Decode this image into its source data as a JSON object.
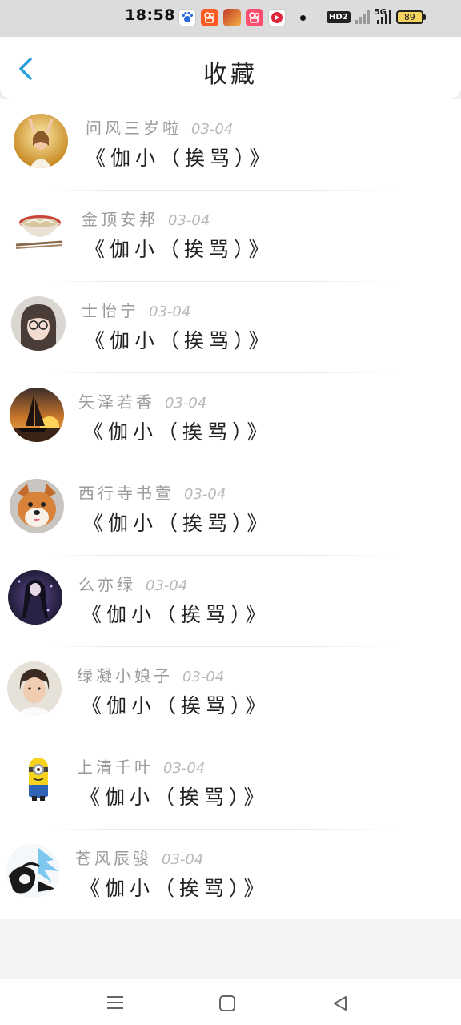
{
  "status_bar": {
    "time": "18:58",
    "hd_label": "HD2",
    "network_label": "5G",
    "battery_level": "89"
  },
  "header": {
    "title": "收藏",
    "back_icon": "chevron-left-icon",
    "accent_color": "#2a9fe0"
  },
  "favorites": [
    {
      "name": "问风三岁啦",
      "date": "03-04",
      "book": "《伽小（挨骂）》",
      "avatar": "girl-sunlight"
    },
    {
      "name": "金顶安邦",
      "date": "03-04",
      "book": "《伽小（挨骂）》",
      "avatar": "noodle-bowl"
    },
    {
      "name": "士怡宁",
      "date": "03-04",
      "book": "《伽小（挨骂）》",
      "avatar": "girl-glasses"
    },
    {
      "name": "矢泽若香",
      "date": "03-04",
      "book": "《伽小（挨骂）》",
      "avatar": "sailboat-sunset"
    },
    {
      "name": "西行寺书萱",
      "date": "03-04",
      "book": "《伽小（挨骂）》",
      "avatar": "shiba-dog"
    },
    {
      "name": "么亦绿",
      "date": "03-04",
      "book": "《伽小（挨骂）》",
      "avatar": "anime-girl-dark"
    },
    {
      "name": "绿凝小娘子",
      "date": "03-04",
      "book": "《伽小（挨骂）》",
      "avatar": "young-man"
    },
    {
      "name": "上清千叶",
      "date": "03-04",
      "book": "《伽小（挨骂）》",
      "avatar": "minion"
    },
    {
      "name": "苍风辰骏",
      "date": "03-04",
      "book": "《伽小（挨骂）》",
      "avatar": "anime-sketch"
    }
  ],
  "nav_bar": {
    "menu_icon": "menu-icon",
    "home_icon": "home-square-icon",
    "back_icon": "back-triangle-icon"
  }
}
